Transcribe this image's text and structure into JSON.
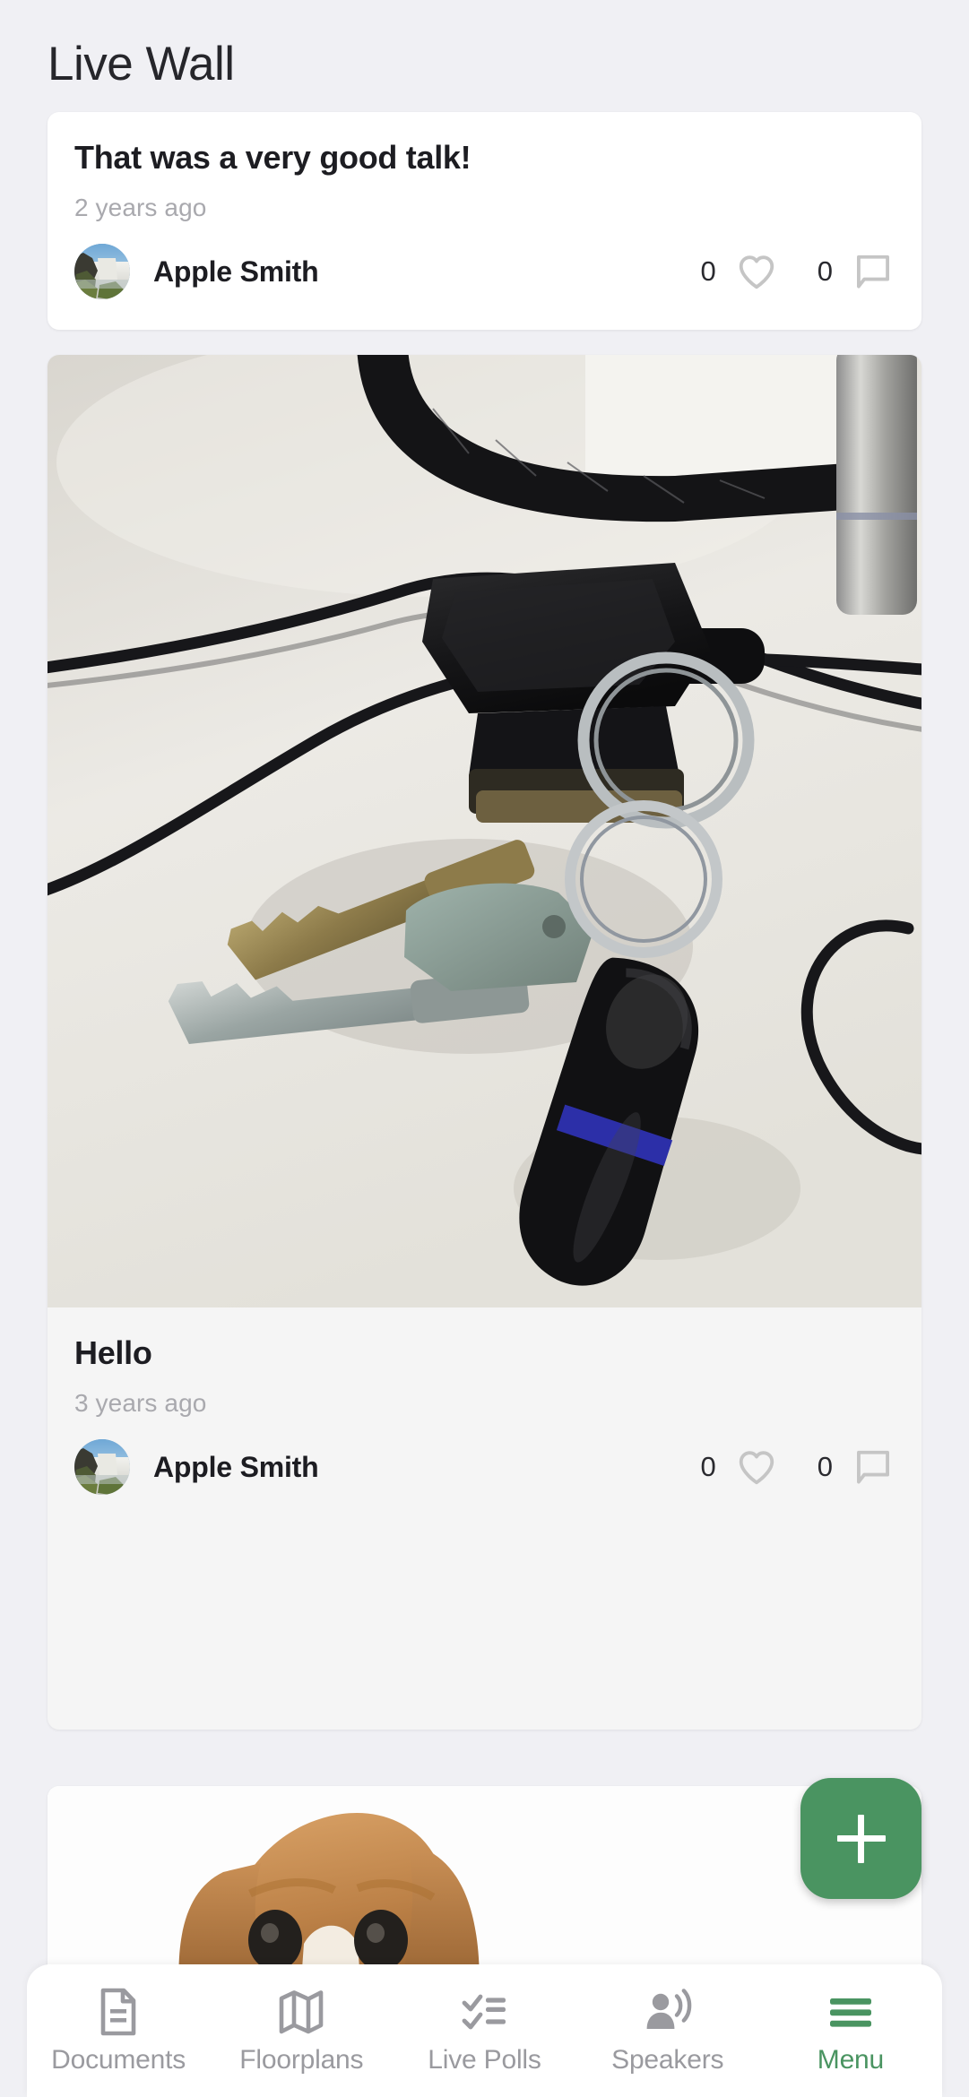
{
  "header": {
    "title": "Live Wall"
  },
  "posts": [
    {
      "title": "That was a very good talk!",
      "time": "2 years ago",
      "author": "Apple Smith",
      "likes": "0",
      "comments": "0",
      "has_image": false
    },
    {
      "title": "Hello",
      "time": "3 years ago",
      "author": "Apple Smith",
      "likes": "0",
      "comments": "0",
      "has_image": true,
      "image_alt": "Keys with black fob on a white desk with cables"
    },
    {
      "has_image": true,
      "image_alt": "Close-up of a beagle dog face"
    }
  ],
  "fab": {
    "label": "+",
    "icon": "plus-icon",
    "color": "#4a9461"
  },
  "bottom_nav": {
    "items": [
      {
        "label": "Documents",
        "icon": "document-icon",
        "active": false
      },
      {
        "label": "Floorplans",
        "icon": "map-icon",
        "active": false
      },
      {
        "label": "Live Polls",
        "icon": "checklist-icon",
        "active": false
      },
      {
        "label": "Speakers",
        "icon": "person-speak-icon",
        "active": false
      },
      {
        "label": "Menu",
        "icon": "hamburger-icon",
        "active": true
      }
    ],
    "active_color": "#4a9461",
    "inactive_color": "#9a9a9f"
  },
  "icons": {
    "like": "heart-icon",
    "comment": "comment-icon"
  }
}
